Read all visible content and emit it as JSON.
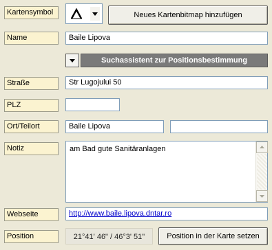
{
  "symbol": {
    "label": "Kartensymbol",
    "icon": "map-symbol-icon",
    "add_button_label": "Neues Kartenbitmap hinzufügen"
  },
  "name": {
    "label": "Name",
    "value": "Baile Lipova"
  },
  "assistant": {
    "label": "Suchassistent zur Positionsbestimmung"
  },
  "street": {
    "label": "Straße",
    "value": "Str Lugojului 50"
  },
  "zip": {
    "label": "PLZ",
    "value": ""
  },
  "town": {
    "label": "Ort/Teilort",
    "value": "Baile Lipova",
    "subvalue": ""
  },
  "note": {
    "label": "Notiz",
    "value": "am Bad gute Sanitäranlagen"
  },
  "website": {
    "label": "Webseite",
    "value": "http://www.baile.lipova.dntar.ro"
  },
  "position": {
    "label": "Position",
    "coords": "21°41' 46\" / 46°3' 51\"",
    "set_button_label": "Position in der Karte setzen"
  },
  "colors": {
    "label_bg": "#fbf3d0",
    "window_bg": "#ece9d8",
    "assistant_bg": "#7a7a7a",
    "link": "#0000cc"
  }
}
